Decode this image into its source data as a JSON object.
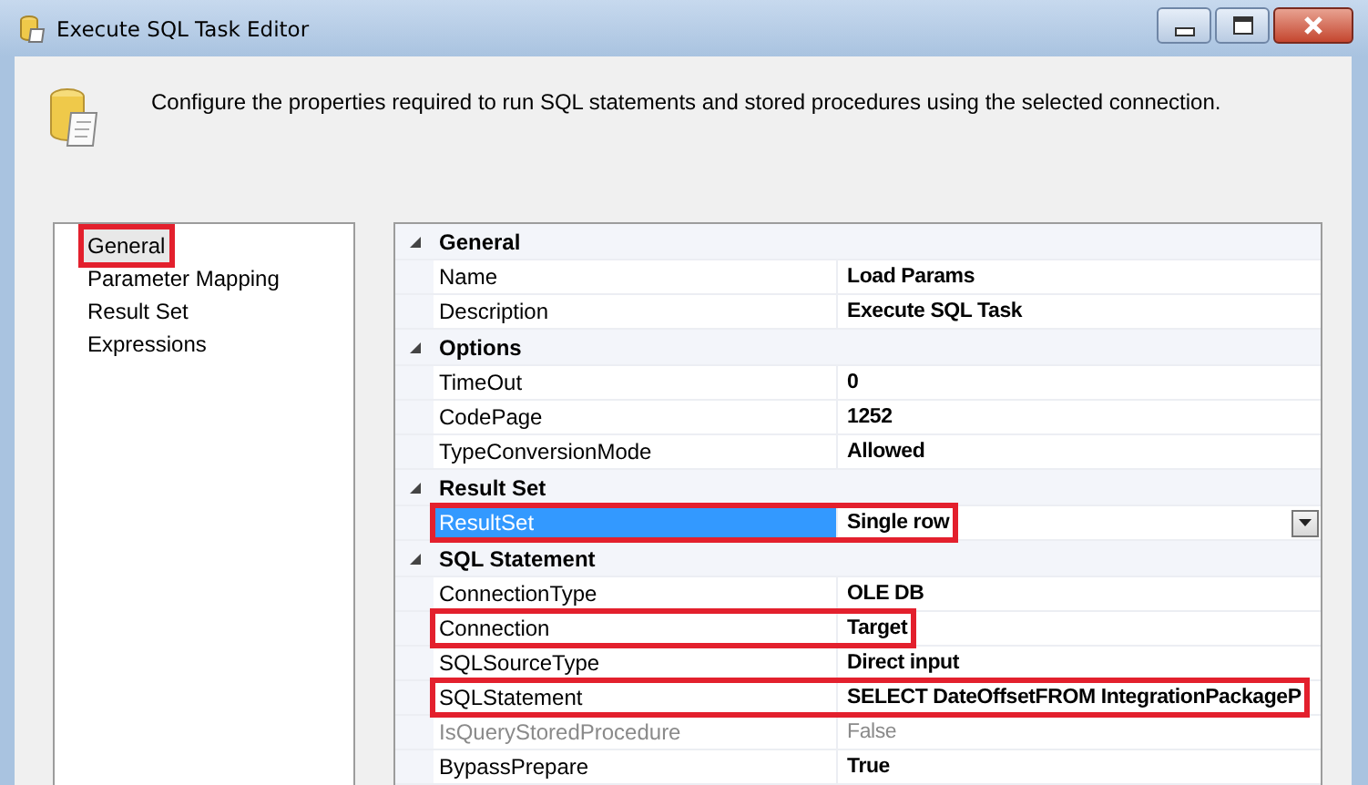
{
  "window": {
    "title": "Execute SQL Task Editor"
  },
  "header": {
    "description": "Configure the properties required to run SQL statements and stored procedures using the selected connection."
  },
  "nav": [
    {
      "label": "General",
      "selected": true,
      "highlighted": true
    },
    {
      "label": "Parameter Mapping",
      "selected": false,
      "highlighted": false
    },
    {
      "label": "Result Set",
      "selected": false,
      "highlighted": false
    },
    {
      "label": "Expressions",
      "selected": false,
      "highlighted": false
    }
  ],
  "properties": [
    {
      "category": "General",
      "expanded": true,
      "rows": [
        {
          "name": "Name",
          "value": "Load Params",
          "selected": false,
          "disabled": false,
          "highlighted": false,
          "dropdown": false
        },
        {
          "name": "Description",
          "value": "Execute SQL Task",
          "selected": false,
          "disabled": false,
          "highlighted": false,
          "dropdown": false
        }
      ]
    },
    {
      "category": "Options",
      "expanded": true,
      "rows": [
        {
          "name": "TimeOut",
          "value": "0",
          "selected": false,
          "disabled": false,
          "highlighted": false,
          "dropdown": false
        },
        {
          "name": "CodePage",
          "value": "1252",
          "selected": false,
          "disabled": false,
          "highlighted": false,
          "dropdown": false
        },
        {
          "name": "TypeConversionMode",
          "value": "Allowed",
          "selected": false,
          "disabled": false,
          "highlighted": false,
          "dropdown": false
        }
      ]
    },
    {
      "category": "Result Set",
      "expanded": true,
      "rows": [
        {
          "name": "ResultSet",
          "value": "Single row",
          "selected": true,
          "disabled": false,
          "highlighted": true,
          "dropdown": true
        }
      ]
    },
    {
      "category": "SQL Statement",
      "expanded": true,
      "rows": [
        {
          "name": "ConnectionType",
          "value": "OLE DB",
          "selected": false,
          "disabled": false,
          "highlighted": false,
          "dropdown": false
        },
        {
          "name": "Connection",
          "value": "Target",
          "selected": false,
          "disabled": false,
          "highlighted": true,
          "dropdown": false
        },
        {
          "name": "SQLSourceType",
          "value": "Direct input",
          "selected": false,
          "disabled": false,
          "highlighted": false,
          "dropdown": false
        },
        {
          "name": "SQLStatement",
          "value": "SELECT DateOffsetFROM IntegrationPackageP",
          "selected": false,
          "disabled": false,
          "highlighted": true,
          "dropdown": false
        },
        {
          "name": "IsQueryStoredProcedure",
          "value": "False",
          "selected": false,
          "disabled": true,
          "highlighted": false,
          "dropdown": false
        },
        {
          "name": "BypassPrepare",
          "value": "True",
          "selected": false,
          "disabled": false,
          "highlighted": false,
          "dropdown": false
        }
      ]
    }
  ]
}
